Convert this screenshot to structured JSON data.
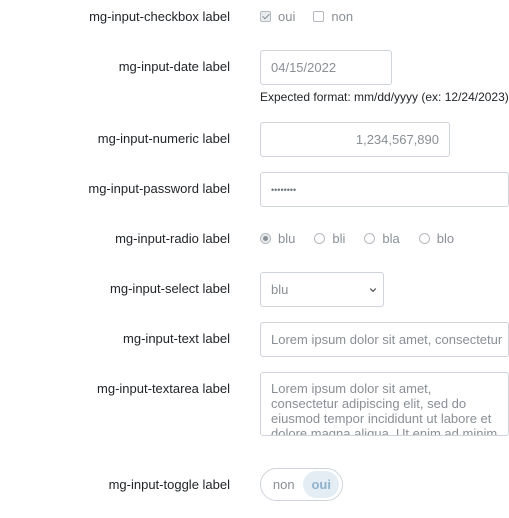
{
  "checkbox": {
    "label": "mg-input-checkbox label",
    "options": [
      {
        "label": "oui",
        "checked": true
      },
      {
        "label": "non",
        "checked": false
      }
    ]
  },
  "date": {
    "label": "mg-input-date label",
    "value": "04/15/2022",
    "help": "Expected format: mm/dd/yyyy (ex: 12/24/2023)"
  },
  "numeric": {
    "label": "mg-input-numeric label",
    "value": "1,234,567,890"
  },
  "password": {
    "label": "mg-input-password label",
    "value": "••••••••"
  },
  "radio": {
    "label": "mg-input-radio label",
    "options": [
      {
        "label": "blu",
        "checked": true
      },
      {
        "label": "bli",
        "checked": false
      },
      {
        "label": "bla",
        "checked": false
      },
      {
        "label": "blo",
        "checked": false
      }
    ]
  },
  "select": {
    "label": "mg-input-select label",
    "value": "blu"
  },
  "text": {
    "label": "mg-input-text label",
    "value": "Lorem ipsum dolor sit amet, consectetur"
  },
  "textarea": {
    "label": "mg-input-textarea label",
    "value": "Lorem ipsum dolor sit amet, consectetur adipiscing elit, sed do eiusmod tempor incididunt ut labore et dolore magna aliqua. Ut enim ad minim"
  },
  "toggle": {
    "label": "mg-input-toggle label",
    "off_label": "non",
    "on_label": "oui"
  }
}
